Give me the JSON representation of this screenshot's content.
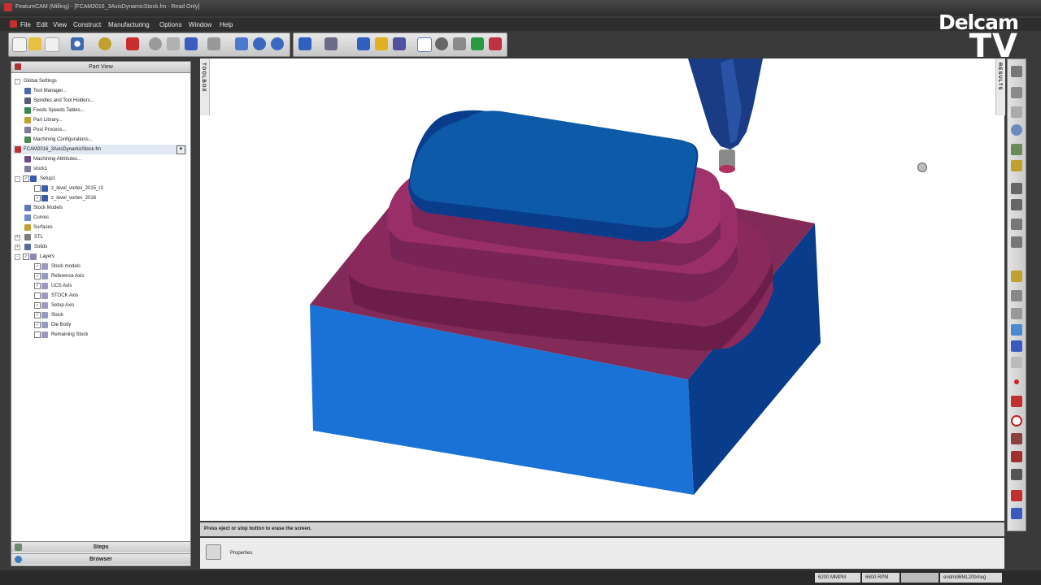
{
  "window": {
    "title": "FeatureCAM (Milling) - [FCAM2016_3AxisDynamicStock.fm - Read Only]"
  },
  "menu": [
    "File",
    "Edit",
    "View",
    "Construct",
    "Manufacturing",
    "Options",
    "Window",
    "Help"
  ],
  "brand": {
    "line1": "Delcam",
    "line2": "TV"
  },
  "part_view": {
    "title": "Part View",
    "tree": [
      {
        "label": "Global Settings"
      },
      {
        "label": "Tool Manager..."
      },
      {
        "label": "Spindles and Tool Holders..."
      },
      {
        "label": "Feeds  Speeds Tables..."
      },
      {
        "label": "Part Library..."
      },
      {
        "label": "Post Process..."
      },
      {
        "label": "Machining Configurations..."
      },
      {
        "label": "FCAM2016_3AxisDynamicStock.fm"
      },
      {
        "label": "Machining Attributes..."
      },
      {
        "label": "stock1"
      },
      {
        "label": "Setup1"
      },
      {
        "label": "z_level_vortex_2015_r3"
      },
      {
        "label": "z_level_vortex_2016"
      },
      {
        "label": "Stock Models"
      },
      {
        "label": "Curves"
      },
      {
        "label": "Surfaces"
      },
      {
        "label": "STL"
      },
      {
        "label": "Solids"
      },
      {
        "label": "Layers"
      },
      {
        "label": "Stock models"
      },
      {
        "label": "Reference Axis"
      },
      {
        "label": "UCS Axis"
      },
      {
        "label": "STOCK Axis"
      },
      {
        "label": "Setup Axis"
      },
      {
        "label": "Stock"
      },
      {
        "label": "Die Body"
      },
      {
        "label": "Remaining Stock"
      }
    ],
    "footer": {
      "steps": "Steps",
      "browser": "Browser"
    }
  },
  "toolbox_tab": "TOOLBOX",
  "results_tab": "RESULTS",
  "message": "Press eject or stop button to erase the screen.",
  "properties": {
    "label": "Properties"
  },
  "status": {
    "feed": "6200 MMPM",
    "speed": "6600 RPM",
    "tool": "endmill6ML20bmeg"
  }
}
